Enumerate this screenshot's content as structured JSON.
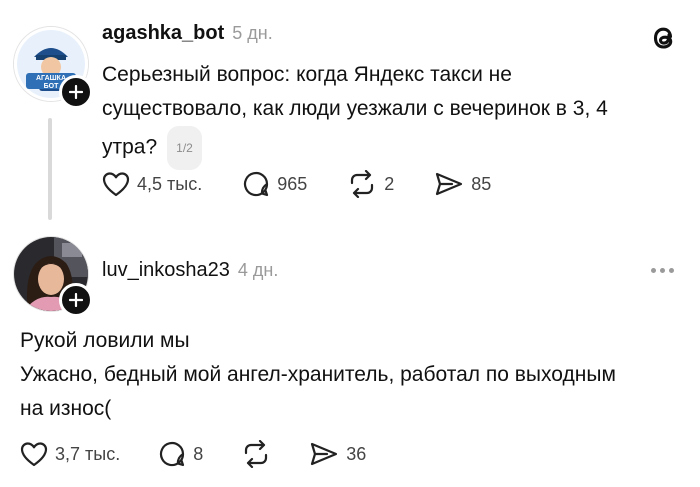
{
  "app": {
    "logo_icon": "threads-logo-icon"
  },
  "posts": [
    {
      "username": "agashka_bot",
      "time": "5 дн.",
      "avatar_label": "АГАШКА БОТ",
      "text": "Серьезный вопрос: когда Яндекс такси не существовало, как люди уезжали с вечеринок в 3, 4 утра?",
      "text_lines": [
        "Серьезный вопрос: когда Яндекс такси не",
        "существовало, как люди уезжали с вечеринок в 3, 4",
        "утра?"
      ],
      "pager": "1/2",
      "actions": {
        "likes": "4,5 тыс.",
        "comments": "965",
        "reposts": "2",
        "shares": "85"
      }
    },
    {
      "username": "luv_inkosha23",
      "time": "4 дн.",
      "text_lines": [
        "Рукой ловили мы",
        "Ужасно, бедный мой ангел-хранитель, работал по выходным",
        "на износ("
      ],
      "actions": {
        "likes": "3,7 тыс.",
        "comments": "8",
        "reposts": "",
        "shares": "36"
      }
    }
  ],
  "colors": {
    "text": "#111111",
    "muted": "#9a9a9a",
    "thread_line": "#d9d9d9"
  }
}
